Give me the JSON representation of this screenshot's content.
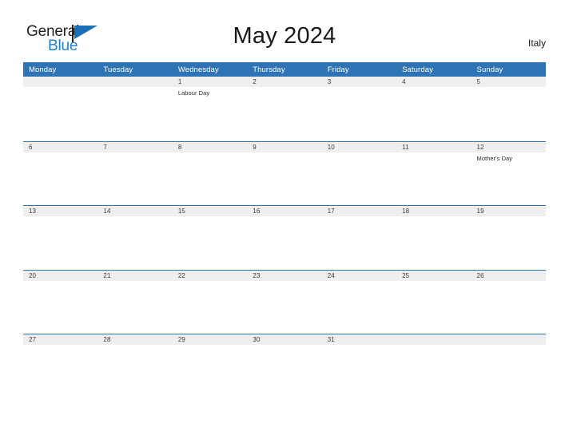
{
  "brand": {
    "name_part1": "General",
    "name_part2": "Blue",
    "flag_icon": "blue-triangle-flag-icon"
  },
  "header": {
    "title": "May 2024",
    "country": "Italy"
  },
  "colors": {
    "header_blue": "#2e74b5",
    "row_separator_blue": "#2e74b5",
    "day_band_gray": "#efefef",
    "logo_blue": "#1f7fd0",
    "text_dark": "#1a1a1a"
  },
  "calendar": {
    "weekdays": [
      "Monday",
      "Tuesday",
      "Wednesday",
      "Thursday",
      "Friday",
      "Saturday",
      "Sunday"
    ],
    "weeks": [
      [
        {
          "date": "",
          "events": []
        },
        {
          "date": "",
          "events": []
        },
        {
          "date": "1",
          "events": [
            "Labour Day"
          ]
        },
        {
          "date": "2",
          "events": []
        },
        {
          "date": "3",
          "events": []
        },
        {
          "date": "4",
          "events": []
        },
        {
          "date": "5",
          "events": []
        }
      ],
      [
        {
          "date": "6",
          "events": []
        },
        {
          "date": "7",
          "events": []
        },
        {
          "date": "8",
          "events": []
        },
        {
          "date": "9",
          "events": []
        },
        {
          "date": "10",
          "events": []
        },
        {
          "date": "11",
          "events": []
        },
        {
          "date": "12",
          "events": [
            "Mother's Day"
          ]
        }
      ],
      [
        {
          "date": "13",
          "events": []
        },
        {
          "date": "14",
          "events": []
        },
        {
          "date": "15",
          "events": []
        },
        {
          "date": "16",
          "events": []
        },
        {
          "date": "17",
          "events": []
        },
        {
          "date": "18",
          "events": []
        },
        {
          "date": "19",
          "events": []
        }
      ],
      [
        {
          "date": "20",
          "events": []
        },
        {
          "date": "21",
          "events": []
        },
        {
          "date": "22",
          "events": []
        },
        {
          "date": "23",
          "events": []
        },
        {
          "date": "24",
          "events": []
        },
        {
          "date": "25",
          "events": []
        },
        {
          "date": "26",
          "events": []
        }
      ],
      [
        {
          "date": "27",
          "events": []
        },
        {
          "date": "28",
          "events": []
        },
        {
          "date": "29",
          "events": []
        },
        {
          "date": "30",
          "events": []
        },
        {
          "date": "31",
          "events": []
        },
        {
          "date": "",
          "events": []
        },
        {
          "date": "",
          "events": []
        }
      ]
    ]
  }
}
